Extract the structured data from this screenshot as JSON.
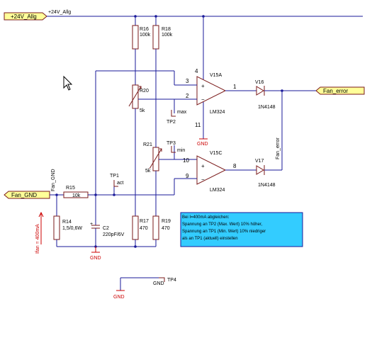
{
  "ports": {
    "supply": "+24V_Allg",
    "gnd_in": "Fan_GND",
    "error_out": "Fan_error"
  },
  "nets": {
    "supply_rail": "+24V_Allg",
    "fan_gnd_net": "Fan_GND",
    "fan_error_net": "Fan_error"
  },
  "components": {
    "r16": {
      "ref": "R16",
      "value": "100k"
    },
    "r18": {
      "ref": "R18",
      "value": "100k"
    },
    "r20": {
      "ref": "R20",
      "value": "5k"
    },
    "r21": {
      "ref": "R21",
      "value": "5k"
    },
    "r15": {
      "ref": "R15",
      "value": "10k"
    },
    "r14": {
      "ref": "R14",
      "value": "1,5/0,6W"
    },
    "r17": {
      "ref": "R17",
      "value": "470"
    },
    "r19": {
      "ref": "R19",
      "value": "470"
    },
    "c2": {
      "ref": "C2",
      "value": "220pF/6V"
    },
    "u_a": {
      "ref": "V15A",
      "part": "LM324"
    },
    "u_c": {
      "ref": "V15C",
      "part": "LM324"
    },
    "d16": {
      "ref": "V16",
      "part": "1N4148"
    },
    "d17": {
      "ref": "V17",
      "part": "1N4148"
    }
  },
  "testpoints": {
    "tp1": {
      "ref": "TP1",
      "label": "act"
    },
    "tp2": {
      "ref": "TP2",
      "label": "max"
    },
    "tp3": {
      "ref": "TP3",
      "label": "min"
    },
    "tp4": {
      "ref": "TP4",
      "label": "GND"
    }
  },
  "pins": {
    "ua_in_plus": "3",
    "ua_in_minus": "2",
    "ua_out": "1",
    "ua_vcc": "4",
    "ua_gnd": "11",
    "uc_in_plus": "10",
    "uc_in_minus": "9",
    "uc_out": "8"
  },
  "ground_labels": {
    "g1": "GND",
    "g2": "GND",
    "g3": "GND"
  },
  "current_label": "Ifan = 400mA",
  "note": {
    "line1": "Bei I=400mA abgleichen:",
    "line2": "Spannung an TP2 (Max. Wert) 10% höher,",
    "line3": "Spannung an TP1 (Min. Wert) 10% niedriger",
    "line4": "als an TP1 (aktuell) einstellen",
    "bg_color": "#33ccff"
  },
  "colors": {
    "wire": "#1a1a9a",
    "component": "#7a1a1a",
    "ground": "#cc0000",
    "port_fill": "#ffff99"
  }
}
